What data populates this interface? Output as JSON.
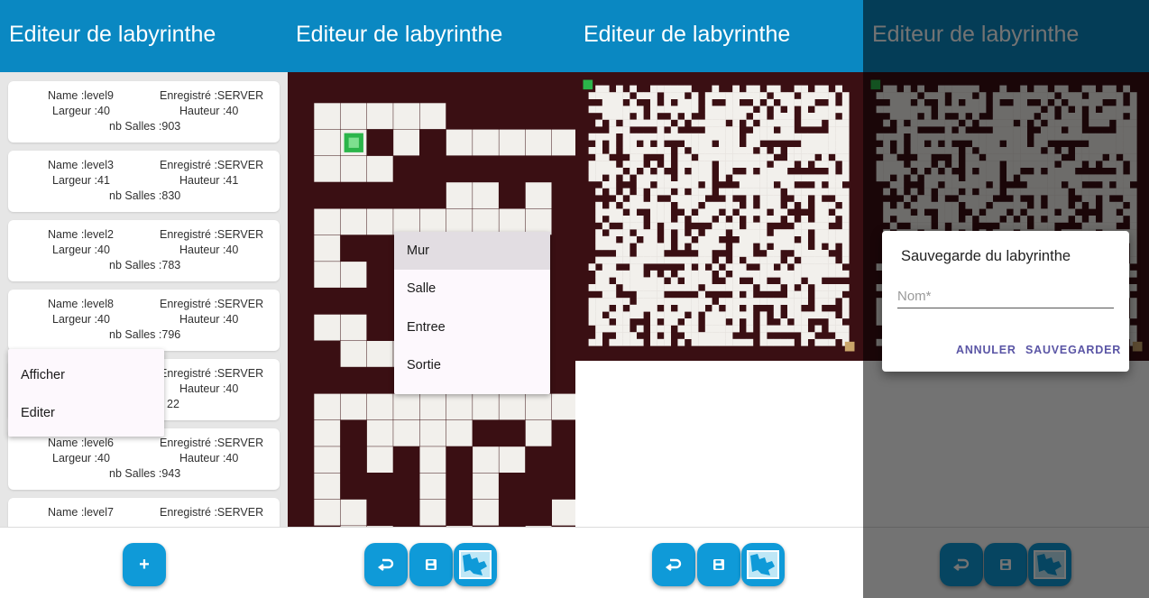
{
  "app": {
    "title": "Editeur de labyrinthe"
  },
  "labels": {
    "name": "Name :",
    "registered": "Enregistré :",
    "width": "Largeur :",
    "height": "Hauteur :",
    "rooms": "nb Salles :"
  },
  "levels": [
    {
      "name_line": "Name :level9",
      "reg_line": "Enregistré :SERVER",
      "width_line": "Largeur :40",
      "height_line": "Hauteur :40",
      "rooms_line": "nb Salles :903"
    },
    {
      "name_line": "Name :level3",
      "reg_line": "Enregistré :SERVER",
      "width_line": "Largeur :41",
      "height_line": "Hauteur :41",
      "rooms_line": "nb Salles :830"
    },
    {
      "name_line": "Name :level2",
      "reg_line": "Enregistré :SERVER",
      "width_line": "Largeur :40",
      "height_line": "Hauteur :40",
      "rooms_line": "nb Salles :783"
    },
    {
      "name_line": "Name :level8",
      "reg_line": "Enregistré :SERVER",
      "width_line": "Largeur :40",
      "height_line": "Hauteur :40",
      "rooms_line": "nb Salles :796"
    },
    {
      "name_line": "",
      "reg_line": "Enregistré :SERVER",
      "width_line": "",
      "height_line": "Hauteur :40",
      "rooms_line": "22"
    },
    {
      "name_line": "Name :level6",
      "reg_line": "Enregistré :SERVER",
      "width_line": "Largeur :40",
      "height_line": "Hauteur :40",
      "rooms_line": "nb Salles :943"
    },
    {
      "name_line": "Name :level7",
      "reg_line": "Enregistré :SERVER",
      "width_line": "",
      "height_line": "",
      "rooms_line": ""
    }
  ],
  "context_menu": {
    "items": [
      "Afficher",
      "Editer"
    ]
  },
  "tile_menu": {
    "items": [
      "Mur",
      "Salle",
      "Entree",
      "Sortie"
    ],
    "selected": "Mur"
  },
  "add_button": {
    "label": "+"
  },
  "toolbar": {
    "icons": [
      "undo-icon",
      "save-icon",
      "map-icon"
    ]
  },
  "save_dialog": {
    "title": "Sauvegarde du labyrinthe",
    "placeholder": "Nom*",
    "cancel": "ANNULER",
    "save": "SAUVEGARDER"
  },
  "colors": {
    "appbar": "#0a88c2",
    "fab": "#0f9ad8",
    "wall": "#3a0f13",
    "room": "#f2f0ec",
    "entry": "#2bb54a",
    "accent": "#5a55a5"
  }
}
